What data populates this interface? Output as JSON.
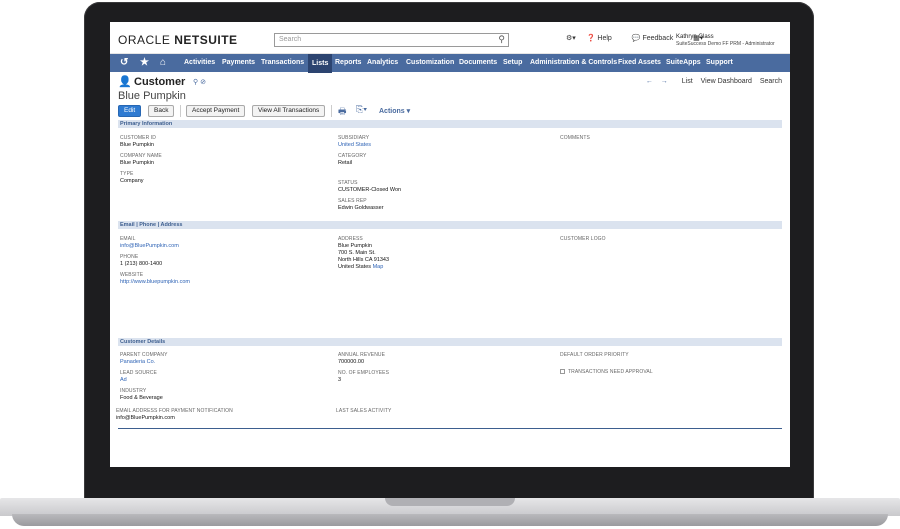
{
  "header": {
    "logo_oracle": "ORACLE",
    "logo_netsuite": "NETSUITE",
    "search_placeholder": "Search",
    "help_label": "Help",
    "feedback_label": "Feedback",
    "user_name": "Kathryn Glass",
    "user_role": "SuiteSuccess Demo FF PRM - Administrator"
  },
  "nav": {
    "items": [
      "Activities",
      "Payments",
      "Transactions",
      "Lists",
      "Reports",
      "Analytics",
      "Customization",
      "Documents",
      "Setup",
      "Administration & Controls",
      "Fixed Assets",
      "SuiteApps",
      "Support"
    ],
    "active": "Lists"
  },
  "record": {
    "type": "Customer",
    "name": "Blue Pumpkin",
    "nav_list": "List",
    "nav_dashboard": "View Dashboard",
    "nav_search": "Search"
  },
  "buttons": {
    "edit": "Edit",
    "back": "Back",
    "accept_payment": "Accept Payment",
    "view_all_transactions": "View All Transactions",
    "actions": "Actions"
  },
  "primary": {
    "title": "Primary Information",
    "customer_id_label": "CUSTOMER ID",
    "customer_id": "Blue Pumpkin",
    "company_name_label": "COMPANY NAME",
    "company_name": "Blue Pumpkin",
    "type_label": "TYPE",
    "type": "Company",
    "subsidiary_label": "SUBSIDIARY",
    "subsidiary": "United States",
    "category_label": "CATEGORY",
    "category": "Retail",
    "status_label": "STATUS",
    "status": "CUSTOMER-Closed Won",
    "sales_rep_label": "SALES REP",
    "sales_rep": "Edwin Goldwasser",
    "comments_label": "COMMENTS"
  },
  "contact": {
    "title": "Email | Phone | Address",
    "email_label": "EMAIL",
    "email": "info@BluePumpkin.com",
    "phone_label": "PHONE",
    "phone": "1 (213) 800-1400",
    "website_label": "WEBSITE",
    "website": "http://www.bluepumpkin.com",
    "address_label": "ADDRESS",
    "address_line1": "Blue Pumpkin",
    "address_line2": "700 S. Main St.",
    "address_line3": "North Hills CA 91343",
    "address_country": "United States",
    "map_link": "Map",
    "logo_label": "CUSTOMER LOGO"
  },
  "details": {
    "title": "Customer Details",
    "parent_label": "PARENT COMPANY",
    "parent": "Panaderia Co.",
    "lead_source_label": "LEAD SOURCE",
    "lead_source": "Ad",
    "industry_label": "INDUSTRY",
    "industry": "Food & Beverage",
    "payment_email_label": "EMAIL ADDRESS FOR PAYMENT NOTIFICATION",
    "payment_email": "info@BluePumpkin.com",
    "annual_revenue_label": "ANNUAL REVENUE",
    "annual_revenue": "700000.00",
    "employees_label": "NO. OF EMPLOYEES",
    "employees": "3",
    "last_sales_label": "LAST SALES ACTIVITY",
    "default_order_priority_label": "DEFAULT ORDER PRIORITY",
    "transactions_approval_label": "TRANSACTIONS NEED APPROVAL"
  }
}
